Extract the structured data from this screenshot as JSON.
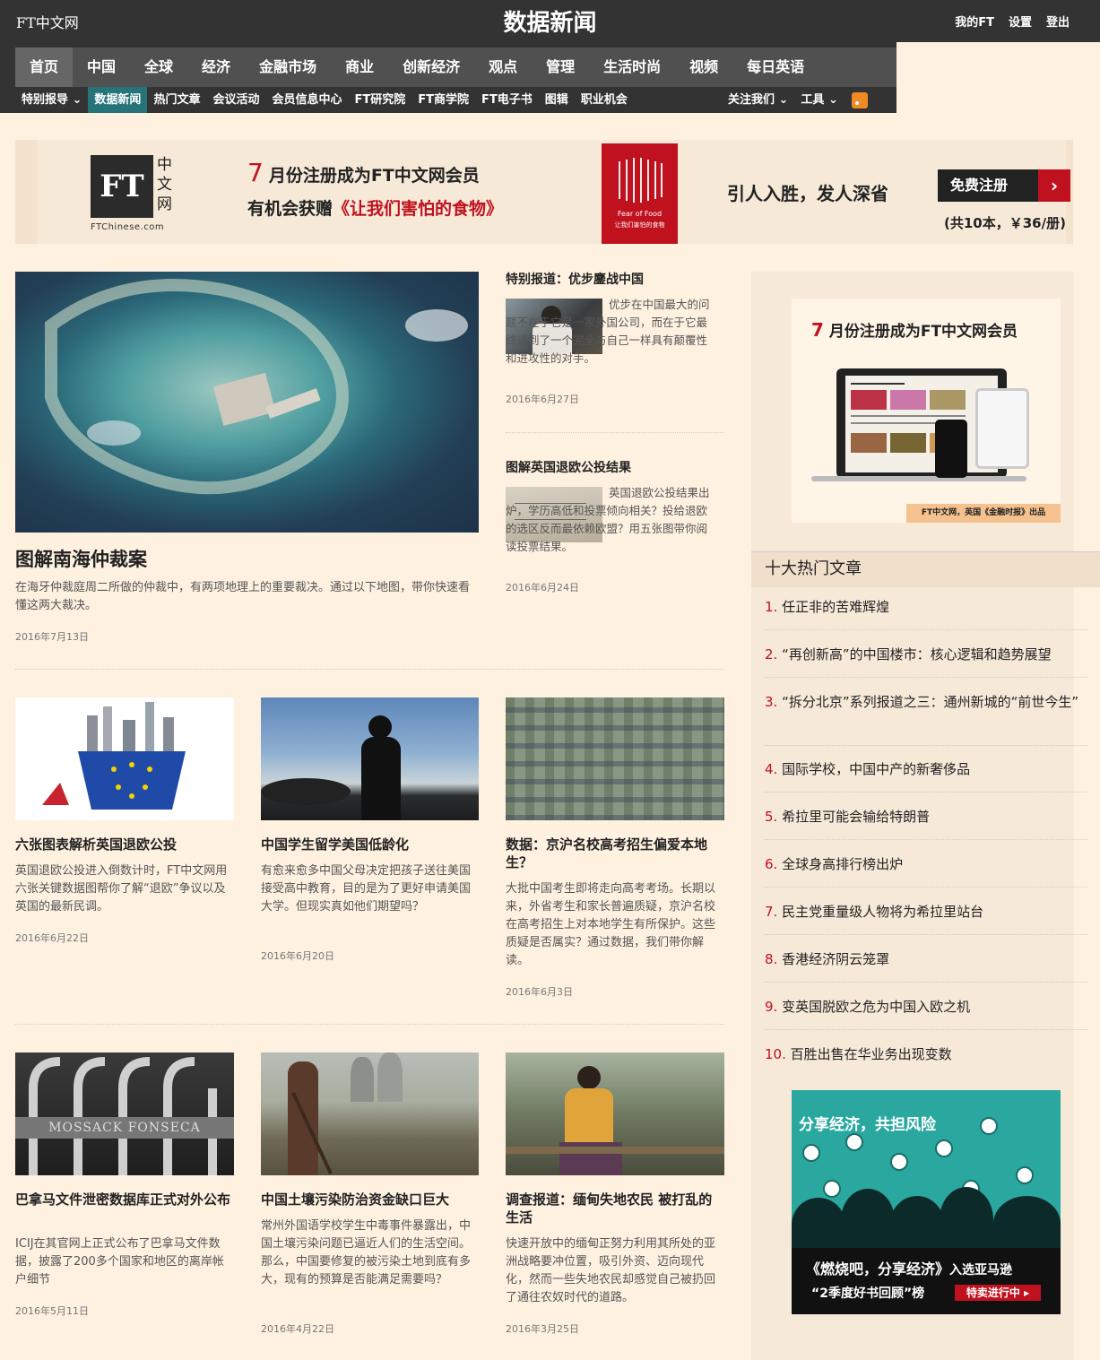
{
  "header": {
    "logo": "FT中文网",
    "page_title": "数据新闻",
    "links": [
      "我的FT",
      "设置",
      "登出"
    ]
  },
  "nav_main": [
    "首页",
    "中国",
    "全球",
    "经济",
    "金融市场",
    "商业",
    "创新经济",
    "观点",
    "管理",
    "生活时尚",
    "视频",
    "每日英语"
  ],
  "nav_sub": [
    "特别报导 ⌄",
    "数据新闻",
    "热门文章",
    "会议活动",
    "会员信息中心",
    "FT研究院",
    "FT商学院",
    "FT电子书",
    "图辑",
    "职业机会"
  ],
  "nav_sub_right": [
    "关注我们 ⌄",
    "工具 ⌄"
  ],
  "banner": {
    "logo_text": "FT",
    "logo_cn": "中文网",
    "logo_url": "FTChinese.com",
    "num": "7",
    "line1": "月份注册成为FT中文网会员",
    "line2a": "有机会获赠",
    "line2b": "《让我们害怕的食物》",
    "slogan": "引人入胜，发人深省",
    "button": "免费注册",
    "price": "(共10本，￥36/册)",
    "book_title": "Fear of Food",
    "book_cn": "让我们害怕的食物"
  },
  "featured": {
    "title": "图解南海仲裁案",
    "desc": "在海牙仲裁庭周二所做的仲裁中，有两项地理上的重要裁决。通过以下地图，带你快速看懂这两大裁决。",
    "date": "2016年7月13日"
  },
  "side_articles": [
    {
      "title": "特别报道：优步鏖战中国",
      "desc": "优步在中国最大的问题不在于它是一家外国公司，而在于它最终遇到了一个完全与自己一样具有颠覆性和进攻性的对手。",
      "date": "2016年6月27日"
    },
    {
      "title": "图解英国退欧公投结果",
      "desc": "英国退欧公投结果出炉，学历高低和投票倾向相关？投给退欧的选区反而最依赖欧盟？用五张图带你阅读投票结果。",
      "date": "2016年6月24日"
    }
  ],
  "grid_articles": [
    {
      "title": "六张图表解析英国退欧公投",
      "desc": "英国退欧公投进入倒数计时，FT中文网用六张关键数据图帮你了解“退欧”争议以及英国的最新民调。",
      "date": "2016年6月22日"
    },
    {
      "title": "中国学生留学美国低龄化",
      "desc": "有愈来愈多中国父母决定把孩子送往美国接受高中教育，目的是为了更好申请美国大学。但现实真如他们期望吗？",
      "date": "2016年6月20日"
    },
    {
      "title": "数据：京沪名校高考招生偏爱本地生？",
      "desc": "大批中国考生即将走向高考考场。长期以来，外省考生和家长普遍质疑，京沪名校在高考招生上对本地学生有所保护。这些质疑是否属实？通过数据，我们带你解读。",
      "date": "2016年6月3日"
    },
    {
      "title": "巴拿马文件泄密数据库正式对外公布",
      "desc": "ICIJ在其官网上正式公布了巴拿马文件数据，披露了200多个国家和地区的离岸帐户细节",
      "date": "2016年5月11日"
    },
    {
      "title": "中国土壤污染防治资金缺口巨大",
      "desc": "常州外国语学校学生中毒事件暴露出，中国土壤污染问题已逼近人们的生活空间。那么，中国要修复的被污染土地到底有多大，现有的预算是否能满足需要吗？",
      "date": "2016年4月22日"
    },
    {
      "title": "调查报道：缅甸失地农民 被打乱的生活",
      "desc": "快速开放中的缅甸正努力利用其所处的亚洲战略要冲位置，吸引外资、迈向现代化，然而一些失地农民却感觉自己被扔回了通往农奴时代的道路。",
      "date": "2016年3月25日"
    }
  ],
  "mossack_text": "MOSSACK FONSECA",
  "sidebar": {
    "ad_num": "7",
    "ad_title": "月份注册成为FT中文网会员",
    "ad_footer": "FT中文网，英国《金融时报》出品",
    "top_title": "十大热门文章",
    "top_list": [
      {
        "n": "1.",
        "t": "任正非的苦难辉煌"
      },
      {
        "n": "2.",
        "t": "“再创新高”的中国楼市：核心逻辑和趋势展望"
      },
      {
        "n": "3.",
        "t": "“拆分北京”系列报道之三：通州新城的“前世今生”"
      },
      {
        "n": "4.",
        "t": "国际学校，中国中产的新奢侈品"
      },
      {
        "n": "5.",
        "t": "希拉里可能会输给特朗普"
      },
      {
        "n": "6.",
        "t": "全球身高排行榜出炉"
      },
      {
        "n": "7.",
        "t": "民主党重量级人物将为希拉里站台"
      },
      {
        "n": "8.",
        "t": "香港经济阴云笼罩"
      },
      {
        "n": "9.",
        "t": "变英国脱欧之危为中国入欧之机"
      },
      {
        "n": "10.",
        "t": "百胜出售在华业务出现变数"
      }
    ],
    "share_head": "分享经济，共担风险",
    "share_l1a": "《燃烧吧，分享经济》",
    "share_l1b": "入选亚马逊",
    "share_l2": "“2季度好书回顾”榜",
    "share_btn": "特卖进行中 ▸"
  }
}
